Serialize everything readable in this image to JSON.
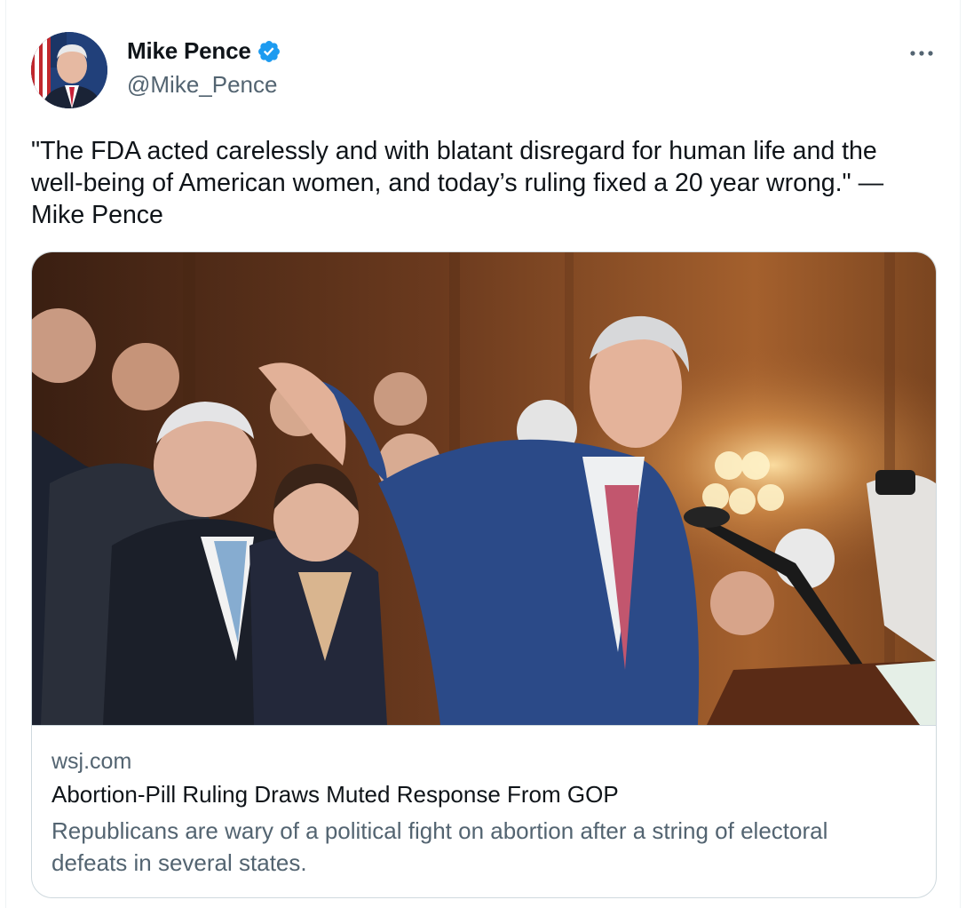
{
  "tweet": {
    "author_name": "Mike Pence",
    "handle": "@Mike_Pence",
    "verified": true,
    "text": "\"The FDA acted carelessly and with blatant disregard for human life and the well-being of American women, and today’s ruling fixed a 20 year wrong.\" — Mike Pence",
    "more_icon": "more-horizontal-icon"
  },
  "link_card": {
    "domain": "wsj.com",
    "headline": "Abortion-Pill Ruling Draws Muted Response From GOP",
    "description": "Republicans are wary of a political fight on abortion after a string of electoral defeats in several states."
  },
  "colors": {
    "text_primary": "#0f1419",
    "text_secondary": "#536471",
    "verified_blue": "#1d9bf0",
    "border": "#cfd9de"
  }
}
